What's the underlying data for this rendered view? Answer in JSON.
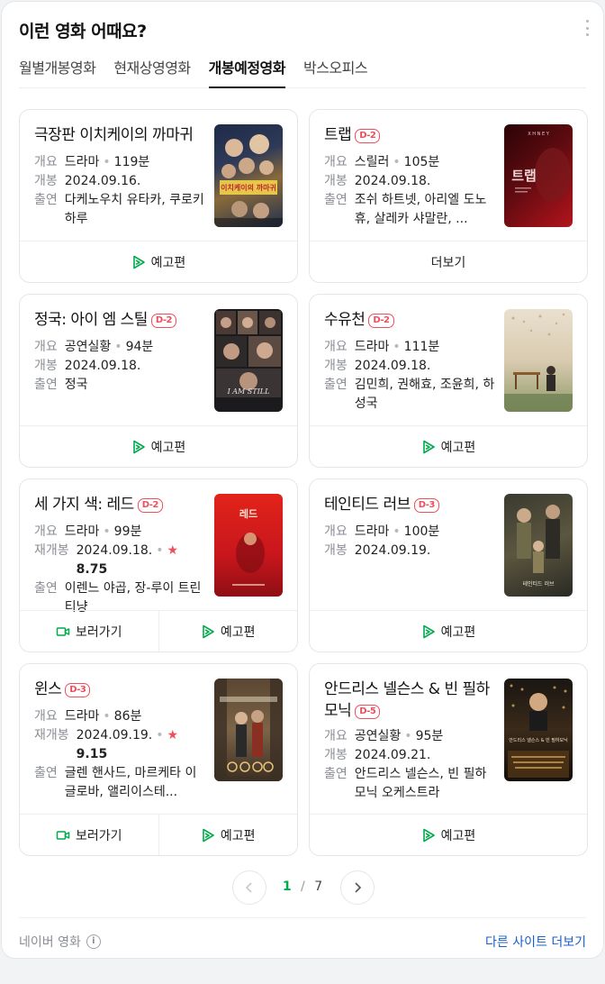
{
  "panel": {
    "title": "이런 영화 어때요?"
  },
  "tabs": [
    "월별개봉영화",
    "현재상영영화",
    "개봉예정영화",
    "박스오피스"
  ],
  "labels": {
    "genre": "개요",
    "release": "개봉",
    "rerelease": "재개봉",
    "cast": "출연"
  },
  "buttons": {
    "trailer": "예고편",
    "watch": "보러가기",
    "more": "더보기"
  },
  "movies": [
    {
      "title": "극장판 이치케이의 까마귀",
      "badge": "",
      "genre": "드라마",
      "runtime": "119분",
      "date": "2024.09.16.",
      "cast": "다케노우치 유타카, 쿠로키 하루"
    },
    {
      "title": "트랩",
      "badge": "D-2",
      "genre": "스릴러",
      "runtime": "105분",
      "date": "2024.09.18.",
      "cast": "조쉬 하트넷, 아리엘 도노휴, 살레카 샤말란, ..."
    },
    {
      "title": "정국: 아이 엠 스틸",
      "badge": "D-2",
      "genre": "공연실황",
      "runtime": "94분",
      "date": "2024.09.18.",
      "cast": "정국"
    },
    {
      "title": "수유천",
      "badge": "D-2",
      "genre": "드라마",
      "runtime": "111분",
      "date": "2024.09.18.",
      "cast": "김민희, 권해효, 조윤희, 하성국"
    },
    {
      "title": "세 가지 색: 레드",
      "badge": "D-2",
      "genre": "드라마",
      "runtime": "99분",
      "date": "2024.09.18.",
      "rating": "8.75",
      "cast": "이렌느 야곱, 장-루이 트린티냥"
    },
    {
      "title": "테인티드 러브",
      "badge": "D-3",
      "genre": "드라마",
      "runtime": "100분",
      "date": "2024.09.19."
    },
    {
      "title": "윈스",
      "badge": "D-3",
      "genre": "드라마",
      "runtime": "86분",
      "date": "2024.09.19.",
      "rating": "9.15",
      "cast": "글렌 핸사드, 마르케타 이글로바, 앨리이스테..."
    },
    {
      "title": "안드리스 넬슨스 & 빈 필하모닉",
      "badge": "D-5",
      "genre": "공연실황",
      "runtime": "95분",
      "date": "2024.09.21.",
      "cast": "안드리스 넬슨스, 빈 필하모닉 오케스트라"
    }
  ],
  "posters": {
    "p1": {
      "banner": "이치케이의 까마귀"
    },
    "p2": {
      "header": "X H N E Y",
      "big": "트랩"
    },
    "p3": {
      "caption": "I AM STILL"
    },
    "p5": {
      "big": "레드"
    },
    "p6": {
      "caption": "테인티드 러브"
    },
    "p8": {
      "caption": "안드리스 넬슨스 & 빈 필하모닉"
    }
  },
  "pager": {
    "current": "1",
    "sep": "/",
    "total": "7"
  },
  "footer": {
    "source": "네이버 영화",
    "info_icon": "i",
    "more_link": "다른 사이트 더보기"
  },
  "colors": {
    "accent": "#03a94d",
    "badge": "#ef4e5c",
    "link": "#1a5fc8"
  }
}
